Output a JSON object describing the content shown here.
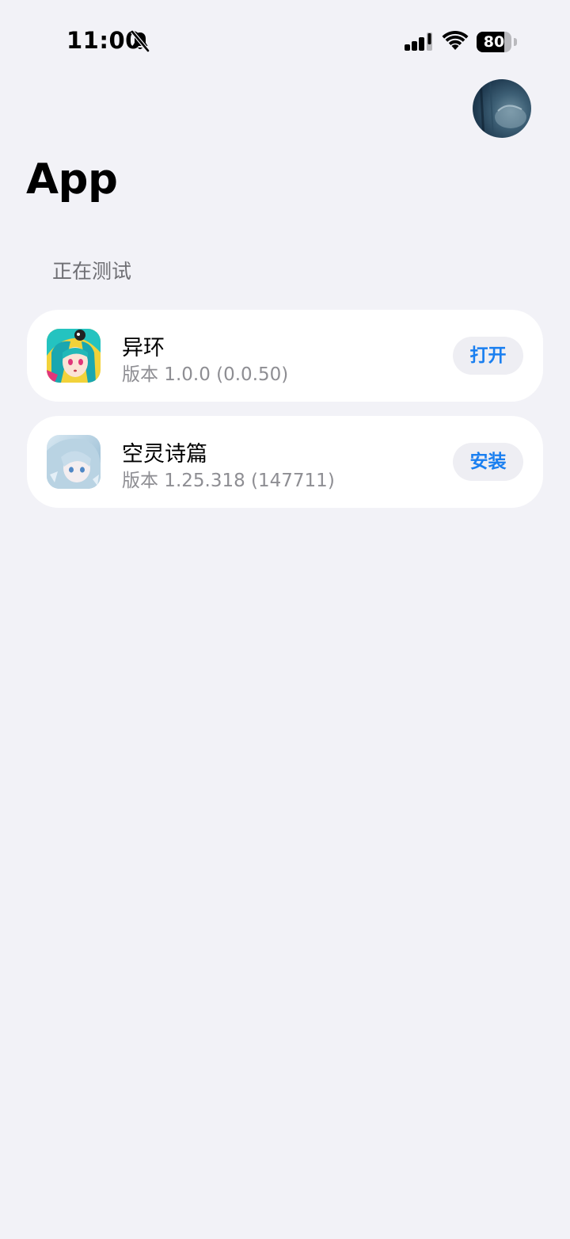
{
  "status_bar": {
    "time": "11:00",
    "battery_level": "80",
    "battery_fraction": 0.8,
    "icons": [
      "bell-slash-icon",
      "cellular-signal-icon",
      "wifi-icon",
      "battery-icon"
    ]
  },
  "header": {
    "title": "App",
    "avatar_icon": "avatar"
  },
  "section": {
    "title": "正在测试"
  },
  "apps": [
    {
      "name": "异环",
      "version": "版本 1.0.0 (0.0.50)",
      "action_label": "打开"
    },
    {
      "name": "空灵诗篇",
      "version": "版本 1.25.318 (147711)",
      "action_label": "安装"
    }
  ],
  "colors": {
    "background": "#f2f2f7",
    "card": "#ffffff",
    "accent": "#1a7ff0",
    "secondary_text": "#8e8e93",
    "button_bg": "#eeeef3"
  }
}
